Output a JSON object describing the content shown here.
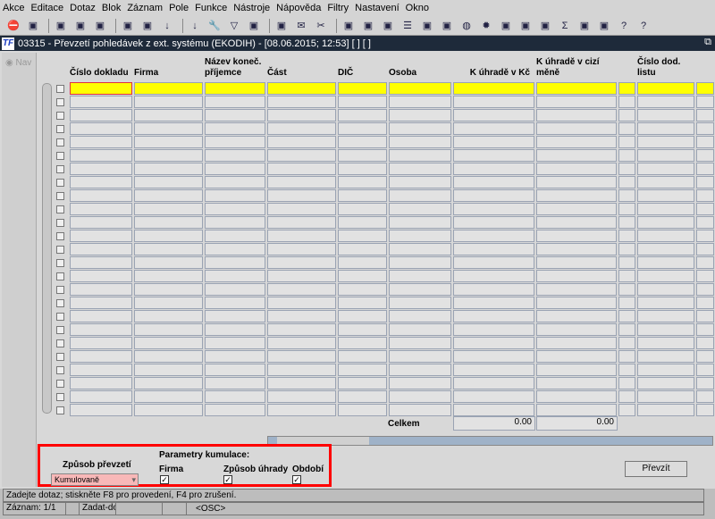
{
  "menu": [
    "Akce",
    "Editace",
    "Dotaz",
    "Blok",
    "Záznam",
    "Pole",
    "Funkce",
    "Nástroje",
    "Nápověda",
    "Filtry",
    "Nastavení",
    "Okno"
  ],
  "toolbar_icons": [
    "exit-icon",
    "insert-record-icon",
    "save-record-icon",
    "delete-record-icon",
    "open-folder-icon",
    "run-icon",
    "clear-icon",
    "sort-asc-icon",
    "sort-desc-icon",
    "wrench-icon",
    "filter-icon",
    "print-icon",
    "print-setup-icon",
    "mail-icon",
    "cut-icon",
    "copy-icon",
    "paste-icon",
    "find-icon",
    "list-icon",
    "calc-icon",
    "doc-icon",
    "globe-icon",
    "gear-icon",
    "chart-icon",
    "calendar-icon",
    "clock-icon",
    "sum-icon",
    "excel-icon",
    "grid-icon",
    "help-icon",
    "context-help-icon"
  ],
  "window": {
    "logo": "TF",
    "title": "03315 - Převzetí pohledávek z ext. systému (EKODIH) - [08.06.2015; 12:53]  [ ]  [ ]",
    "maximize": "⧉"
  },
  "nav_label": "Nav",
  "columns": [
    "Číslo dokladu",
    "Firma",
    "Název koneč. příjemce",
    "Část",
    "DIČ",
    "Osoba",
    "K úhradě v Kč",
    "K úhradě v cizí měně",
    "",
    "Číslo dod. listu",
    ""
  ],
  "totals": {
    "label": "Celkem",
    "kc": "0.00",
    "foreign": "0.00"
  },
  "options": {
    "zpusob_label": "Způsob převzetí",
    "zpusob_value": "Kumulovaně",
    "params_label": "Parametry kumulace:",
    "firma": "Firma",
    "zpusob_uhrady": "Způsob úhrady",
    "obdobi": "Období",
    "check": "✓"
  },
  "button_prevzit": "Převzít",
  "status": {
    "message": "Zadejte dotaz; stiskněte F8 pro provedení, F4 pro zrušení.",
    "record": "Záznam: 1/1",
    "mode": "Zadat-dot...",
    "osc": "<OSC>"
  }
}
